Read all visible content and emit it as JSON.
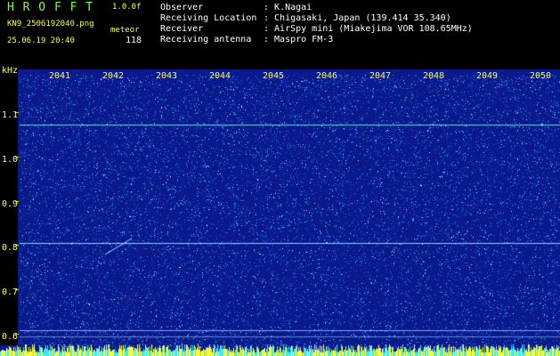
{
  "header": {
    "logo": "H R O F F T",
    "version": "1.0.0f",
    "filename": "KN9_2506192040.png",
    "datetime": "25.06.19 20:40",
    "meteor_label": "meteor",
    "meteor_count": "118",
    "info": [
      {
        "label": "Observer",
        "value": ": K.Nagai"
      },
      {
        "label": "Receiving Location",
        "value": ": Chigasaki, Japan (139.414 35.340)"
      },
      {
        "label": "Receiver",
        "value": ": AirSpy mini (Miakejima VOR 108.65MHz)"
      },
      {
        "label": "Receiving antenna",
        "value": ": Maspro FM-3"
      }
    ]
  },
  "axes": {
    "y_unit": "kHz",
    "x_ticks": [
      "2041",
      "2042",
      "2043",
      "2044",
      "2045",
      "2046",
      "2047",
      "2048",
      "2049",
      "2050"
    ],
    "y_ticks": [
      "1.1",
      "1.0",
      "0.9",
      "0.8",
      "0.7",
      "0.6"
    ]
  },
  "colors": {
    "background": "#0A1A8C",
    "noise_primary": "#2AA0FF",
    "noise_bright": "#A0F0FF",
    "label": "#FFFF40",
    "title": "#7CFF3F"
  }
}
